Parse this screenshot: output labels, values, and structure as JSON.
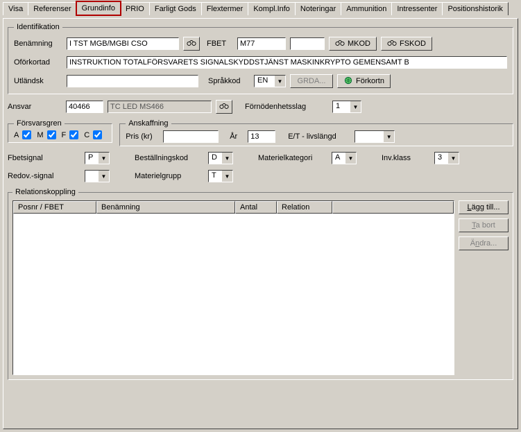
{
  "tabs": [
    "Visa",
    "Referenser",
    "Grundinfo",
    "PRIO",
    "Farligt Gods",
    "Flextermer",
    "Kompl.Info",
    "Noteringar",
    "Ammunition",
    "Intressenter",
    "Positionshistorik"
  ],
  "active_tab": 2,
  "identifikation": {
    "legend": "Identifikation",
    "benamning_label": "Benämning",
    "benamning_value": "I TST MGB/MGBI CSO",
    "fbet_label": "FBET",
    "fbet_value": "M77",
    "fbet_value2": "",
    "mkod_label": "MKOD",
    "fskod_label": "FSKOD",
    "oforkortad_label": "Oförkortad",
    "oforkortad_value": "INSTRUKTION TOTALFÖRSVARETS SIGNALSKYDDSTJÄNST MASKINKRYPTO GEMENSAMT B",
    "utlandsk_label": "Utländsk",
    "utlandsk_value": "",
    "sprakkod_label": "Språkkod",
    "sprakkod_value": "EN",
    "grda_label": "GRDA...",
    "forkortn_label": "Förkortn"
  },
  "ansvar": {
    "label": "Ansvar",
    "code": "40466",
    "name": "TC LED MS466",
    "fornoden_label": "Förnödenhetsslag",
    "fornoden_value": "1"
  },
  "forsvarsgren": {
    "legend": "Försvarsgren",
    "A": true,
    "M": true,
    "F": true,
    "C": true
  },
  "anskaffning": {
    "legend": "Anskaffning",
    "pris_label": "Pris (kr)",
    "pris_value": "",
    "ar_label": "År",
    "ar_value": "13",
    "et_label": "E/T - livslängd",
    "et_value": ""
  },
  "row3": {
    "fbetsignal_label": "Fbetsignal",
    "fbetsignal_value": "P",
    "bestallningskod_label": "Beställningskod",
    "bestallningskod_value": "D",
    "materielkategori_label": "Materielkategori",
    "materielkategori_value": "A",
    "invklass_label": "Inv.klass",
    "invklass_value": "3"
  },
  "row4": {
    "redov_label": "Redov.-signal",
    "redov_value": "",
    "materielgrupp_label": "Materielgrupp",
    "materielgrupp_value": "T"
  },
  "relation": {
    "legend": "Relationskoppling",
    "cols": [
      "Posnr / FBET",
      "Benämning",
      "Antal",
      "Relation",
      ""
    ],
    "lagg_till": "Lägg till...",
    "ta_bort": "Ta bort",
    "andra": "Ändra..."
  }
}
